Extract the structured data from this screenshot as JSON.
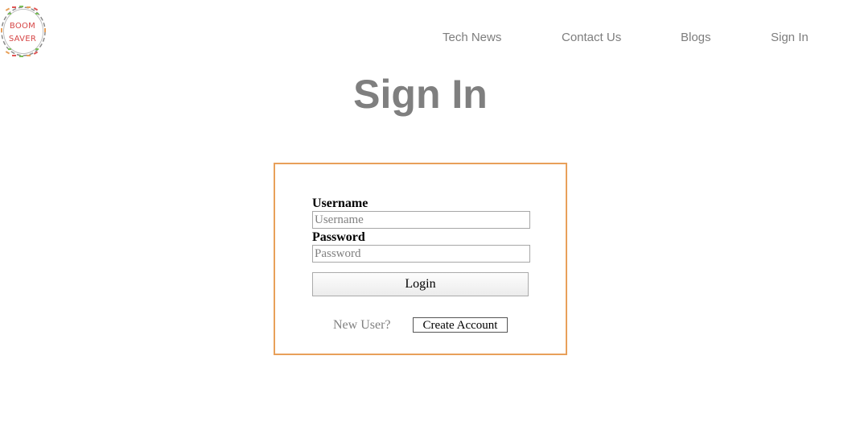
{
  "logo": {
    "line1": "BOOM",
    "line2": "SAVER",
    "icon": "wreath-logo-icon",
    "text_color": "#d64545"
  },
  "nav": {
    "items": [
      {
        "label": "Tech News"
      },
      {
        "label": "Contact Us"
      },
      {
        "label": "Blogs"
      },
      {
        "label": "Sign In"
      }
    ]
  },
  "page": {
    "title": "Sign In"
  },
  "form": {
    "username_label": "Username",
    "username_placeholder": "Username",
    "password_label": "Password",
    "password_placeholder": "Password",
    "login_label": "Login",
    "new_user_text": "New User?",
    "create_account_label": "Create Account",
    "border_color": "#e8a05a"
  }
}
